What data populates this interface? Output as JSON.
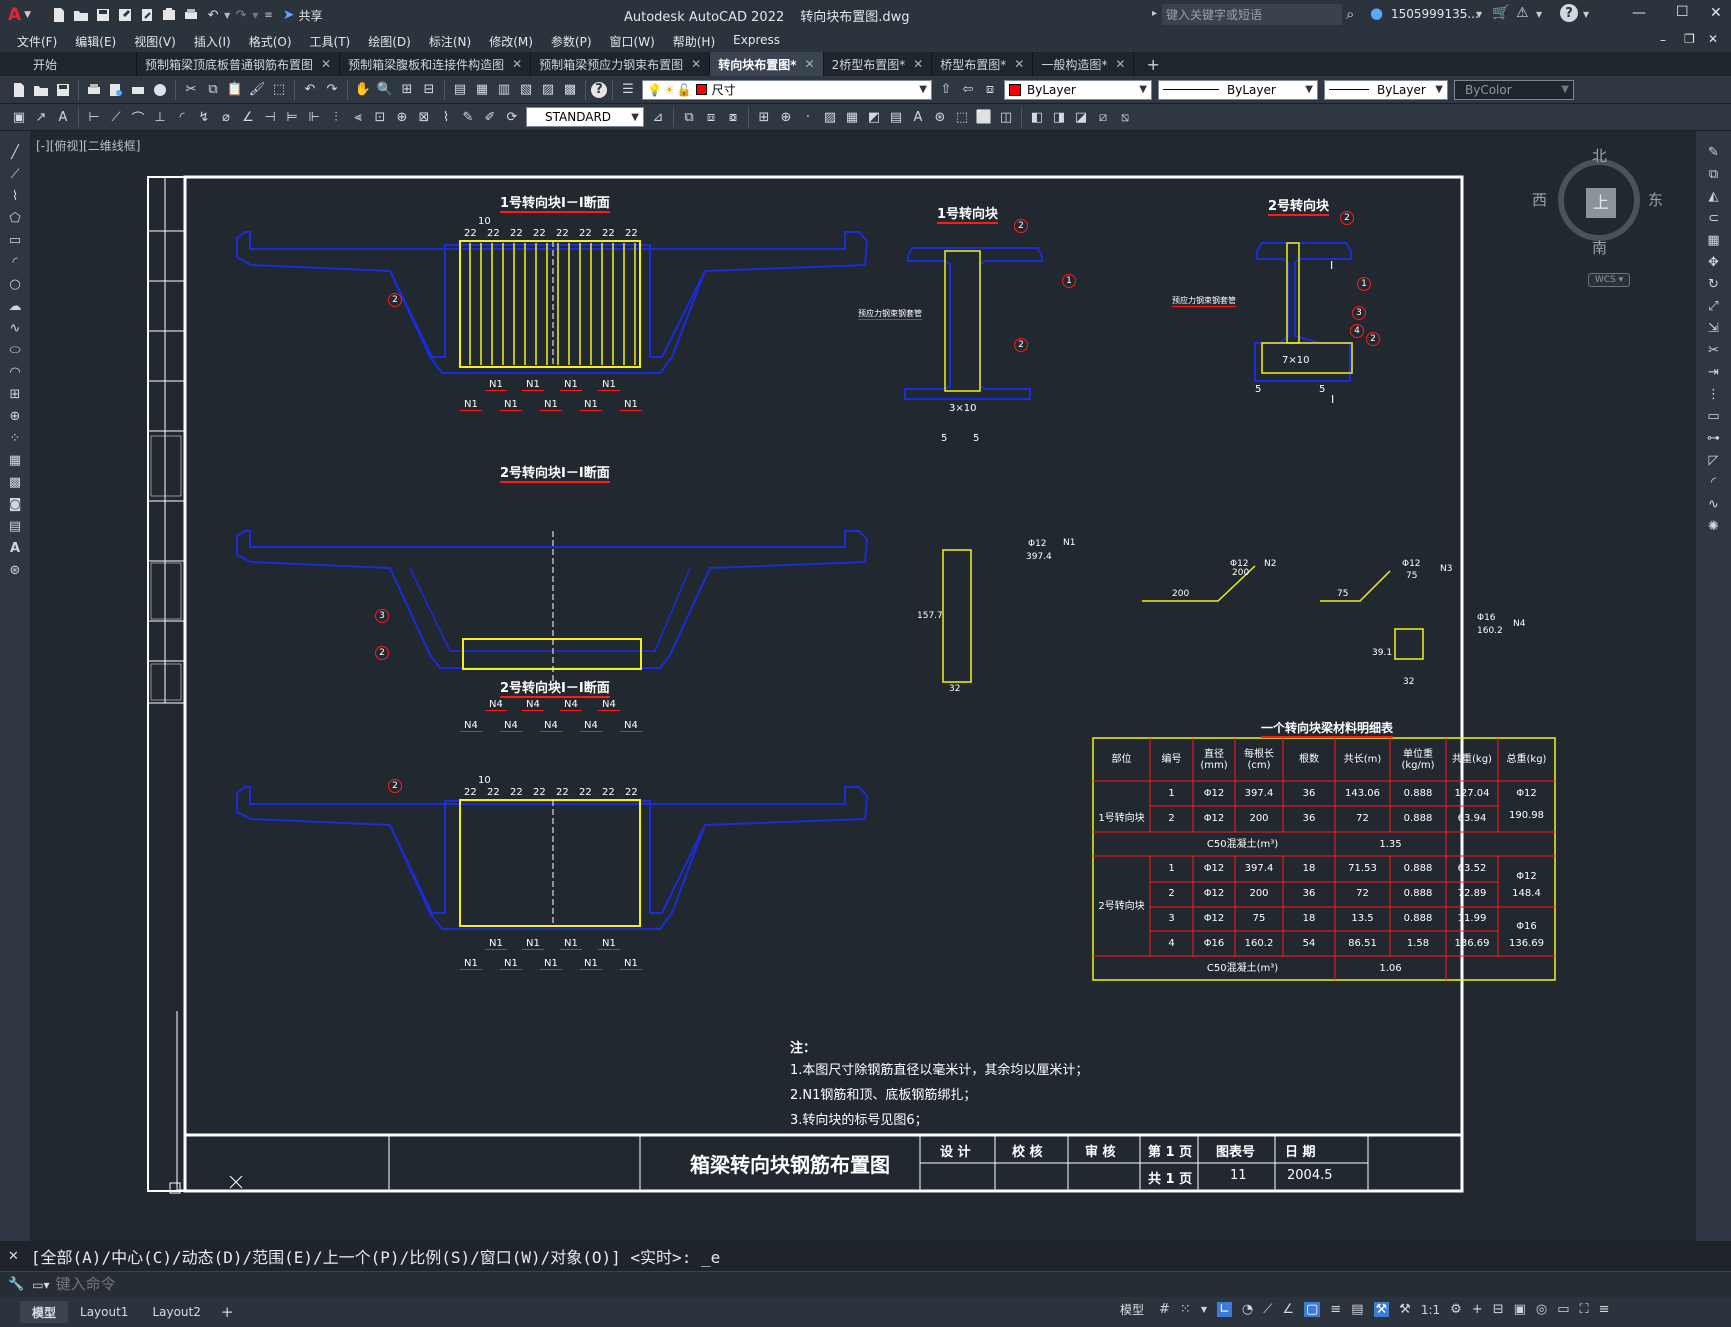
{
  "app": {
    "title": "Autodesk AutoCAD 2022",
    "filename": "转向块布置图.dwg",
    "share_label": "共享",
    "search_placeholder": "键入关键字或短语",
    "user": "1505999135...",
    "win_min": "—",
    "win_max": "☐",
    "win_close": "✕"
  },
  "menu": [
    "文件(F)",
    "编辑(E)",
    "视图(V)",
    "插入(I)",
    "格式(O)",
    "工具(T)",
    "绘图(D)",
    "标注(N)",
    "修改(M)",
    "参数(P)",
    "窗口(W)",
    "帮助(H)",
    "Express"
  ],
  "tabs": [
    {
      "label": "开始",
      "active": false,
      "closable": false
    },
    {
      "label": "预制箱梁顶底板普通钢筋布置图",
      "active": false,
      "closable": true
    },
    {
      "label": "预制箱梁腹板和连接件构造图",
      "active": false,
      "closable": true
    },
    {
      "label": "预制箱梁预应力钢束布置图",
      "active": false,
      "closable": true
    },
    {
      "label": "转向块布置图*",
      "active": true,
      "closable": true
    },
    {
      "label": "2桥型布置图*",
      "active": false,
      "closable": true
    },
    {
      "label": "桥型布置图*",
      "active": false,
      "closable": true
    },
    {
      "label": "一般构造图*",
      "active": false,
      "closable": true
    }
  ],
  "toolbar": {
    "layer_name": "尺寸",
    "color": "ByLayer",
    "linetype": "ByLayer",
    "lineweight": "ByLayer",
    "plotstyle": "ByColor",
    "textstyle": "STANDARD"
  },
  "viewport_label": "[-][俯视][二维线框]",
  "viewcube": {
    "north": "北",
    "south": "南",
    "east": "东",
    "west": "西",
    "top": "上",
    "wcs": "WCS"
  },
  "drawing": {
    "sec1_title": "1号转向块Ⅰ－Ⅰ断面",
    "sec2_title": "2号转向块Ⅰ－Ⅰ断面",
    "sec3_title": "2号转向块Ⅰ－Ⅰ断面",
    "blk1_title": "1号转向块",
    "blk2_title": "2号转向块",
    "dim22": "22",
    "dim10": "10",
    "label_N1": "N1",
    "label_N4": "N4",
    "c1": "1",
    "c2": "2",
    "c3": "3",
    "c4": "4",
    "duct_label": "预应力钢束钢套管",
    "dim_3x10": "3×10",
    "dim_7x10": "7×10",
    "dim_5": "5",
    "roman_I": "Ⅰ",
    "n1_dia": "Φ12",
    "n1_len": "397.4",
    "n1_h": "157.7",
    "n1_w": "32",
    "n1_tag": "N1",
    "n2_dia": "Φ12",
    "n2_len": "200",
    "n2_w": "200",
    "n2_tag": "N2",
    "n3_dia": "Φ12",
    "n3_len": "75",
    "n3_w": "75",
    "n3_tag": "N3",
    "n4_dia": "Φ16",
    "n4_len": "160.2",
    "n4_h": "39.1",
    "n4_w": "32",
    "n4_tag": "N4",
    "table_title": "一个转向块梁材料明细表",
    "table_headers": [
      "部位",
      "编号",
      "直径(mm)",
      "每根长(cm)",
      "根数",
      "共长(m)",
      "单位重(kg/m)",
      "共重(kg)",
      "总重(kg)"
    ],
    "group1_label": "1号转向块",
    "group2_label": "2号转向块",
    "rows1": [
      [
        "1",
        "Φ12",
        "397.4",
        "36",
        "143.06",
        "0.888",
        "127.04"
      ],
      [
        "2",
        "Φ12",
        "200",
        "36",
        "72",
        "0.888",
        "63.94"
      ]
    ],
    "total1": "Φ12\n190.98",
    "total1_a": "Φ12",
    "total1_b": "190.98",
    "concrete1_label": "C50混凝土(m³)",
    "concrete1_val": "1.35",
    "rows2": [
      [
        "1",
        "Φ12",
        "397.4",
        "18",
        "71.53",
        "0.888",
        "63.52"
      ],
      [
        "2",
        "Φ12",
        "200",
        "36",
        "72",
        "0.888",
        "72.89"
      ],
      [
        "3",
        "Φ12",
        "75",
        "18",
        "13.5",
        "0.888",
        "11.99"
      ],
      [
        "4",
        "Φ16",
        "160.2",
        "54",
        "86.51",
        "1.58",
        "136.69"
      ]
    ],
    "total2a_a": "Φ12",
    "total2a_b": "148.4",
    "total2b_a": "Φ16",
    "total2b_b": "136.69",
    "concrete2_label": "C50混凝土(m³)",
    "concrete2_val": "1.06",
    "notes_title": "注：",
    "notes": [
      "1.本图尺寸除钢筋直径以毫米计，其余均以厘米计；",
      "2.N1钢筋和顶、底板钢筋绑扎；",
      "3.转向块的标号见图6；"
    ],
    "tb_title": "箱梁转向块钢筋布置图",
    "tb_design": "设 计",
    "tb_check": "校 核",
    "tb_review": "审 核",
    "tb_page": "第 1 页",
    "tb_total": "共 1 页",
    "tb_drawno_label": "图表号",
    "tb_drawno": "11",
    "tb_date_label": "日 期",
    "tb_date": "2004.5"
  },
  "command": {
    "history": "[全部(A)/中心(C)/动态(D)/范围(E)/上一个(P)/比例(S)/窗口(W)/对象(O)] <实时>: _e",
    "placeholder": "键入命令"
  },
  "layouts": [
    {
      "label": "模型",
      "active": true
    },
    {
      "label": "Layout1",
      "active": false
    },
    {
      "label": "Layout2",
      "active": false
    }
  ],
  "status": {
    "model": "模型",
    "scale": "1:1"
  },
  "colors": {
    "blue": "#1a2dd8",
    "yellow": "#f2ef1c",
    "red": "#ff1a1a",
    "white": "#ffffff",
    "cyan": "#23d7e3"
  }
}
